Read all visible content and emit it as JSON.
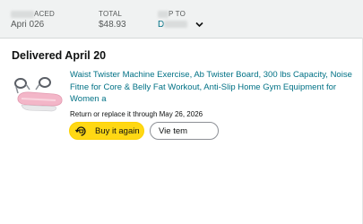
{
  "order_header": {
    "placed_label": "ACED",
    "placed_value": "Apri     026",
    "total_label": "TOTAL",
    "total_value": "$48.93",
    "ship_to_label": "P TO",
    "ship_to_value": "D"
  },
  "shipment": {
    "status": "Delivered April 20"
  },
  "item": {
    "title": "Waist Twister Machine Exercise, Ab Twister Board, 300 lbs Capacity, Noise\nFitne        for Core & Belly Fat Workout, Anti-Slip Home Gym Equipment for\nWomen a",
    "return_text": "Return or replace it              through May 26, 2026",
    "buy_again_label": "Buy it again",
    "view_item_label": "Vie         tem"
  },
  "colors": {
    "link": "#007185",
    "buy_button": "#ffd814",
    "header_bg": "#f0f2f2"
  },
  "icons": {
    "buy_again": "buy-again-icon",
    "ship_to_dropdown": "chevron-down-icon"
  }
}
